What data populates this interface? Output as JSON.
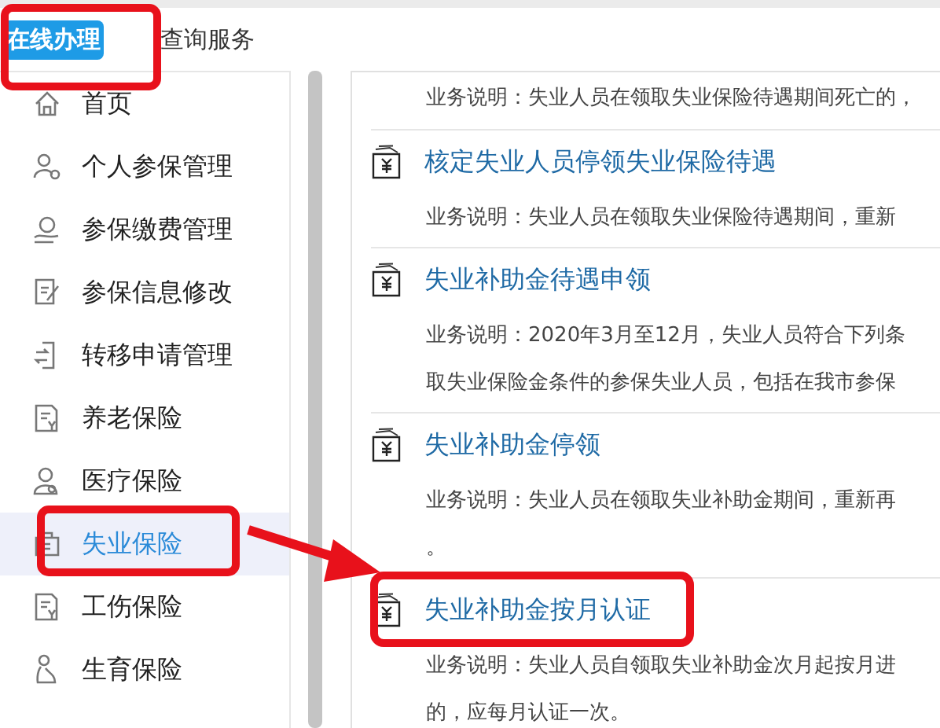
{
  "tabs": [
    {
      "label": "在线办理",
      "selected": true
    },
    {
      "label": "查询服务",
      "selected": false
    }
  ],
  "sidebar": {
    "items": [
      {
        "label": "首页",
        "selected": false
      },
      {
        "label": "个人参保管理",
        "selected": false
      },
      {
        "label": "参保缴费管理",
        "selected": false
      },
      {
        "label": "参保信息修改",
        "selected": false
      },
      {
        "label": "转移申请管理",
        "selected": false
      },
      {
        "label": "养老保险",
        "selected": false
      },
      {
        "label": "医疗保险",
        "selected": false
      },
      {
        "label": "失业保险",
        "selected": true
      },
      {
        "label": "工伤保险",
        "selected": false
      },
      {
        "label": "生育保险",
        "selected": false
      }
    ]
  },
  "content": {
    "items": [
      {
        "description": [
          "业务说明：失业人员在领取失业保险待遇期间死亡的，"
        ]
      },
      {
        "title": "核定失业人员停领失业保险待遇",
        "description": [
          "业务说明：失业人员在领取失业保险待遇期间，重新"
        ]
      },
      {
        "title": "失业补助金待遇申领",
        "description": [
          "业务说明：2020年3月至12月，失业人员符合下列条",
          "取失业保险金条件的参保失业人员，包括在我市参保"
        ]
      },
      {
        "title": "失业补助金停领",
        "description": [
          "业务说明：失业人员在领取失业补助金期间，重新再",
          "。"
        ]
      },
      {
        "title": "失业补助金按月认证",
        "description": [
          "业务说明：失业人员自领取失业补助金次月起按月进",
          "的，应每月认证一次。"
        ]
      }
    ]
  }
}
